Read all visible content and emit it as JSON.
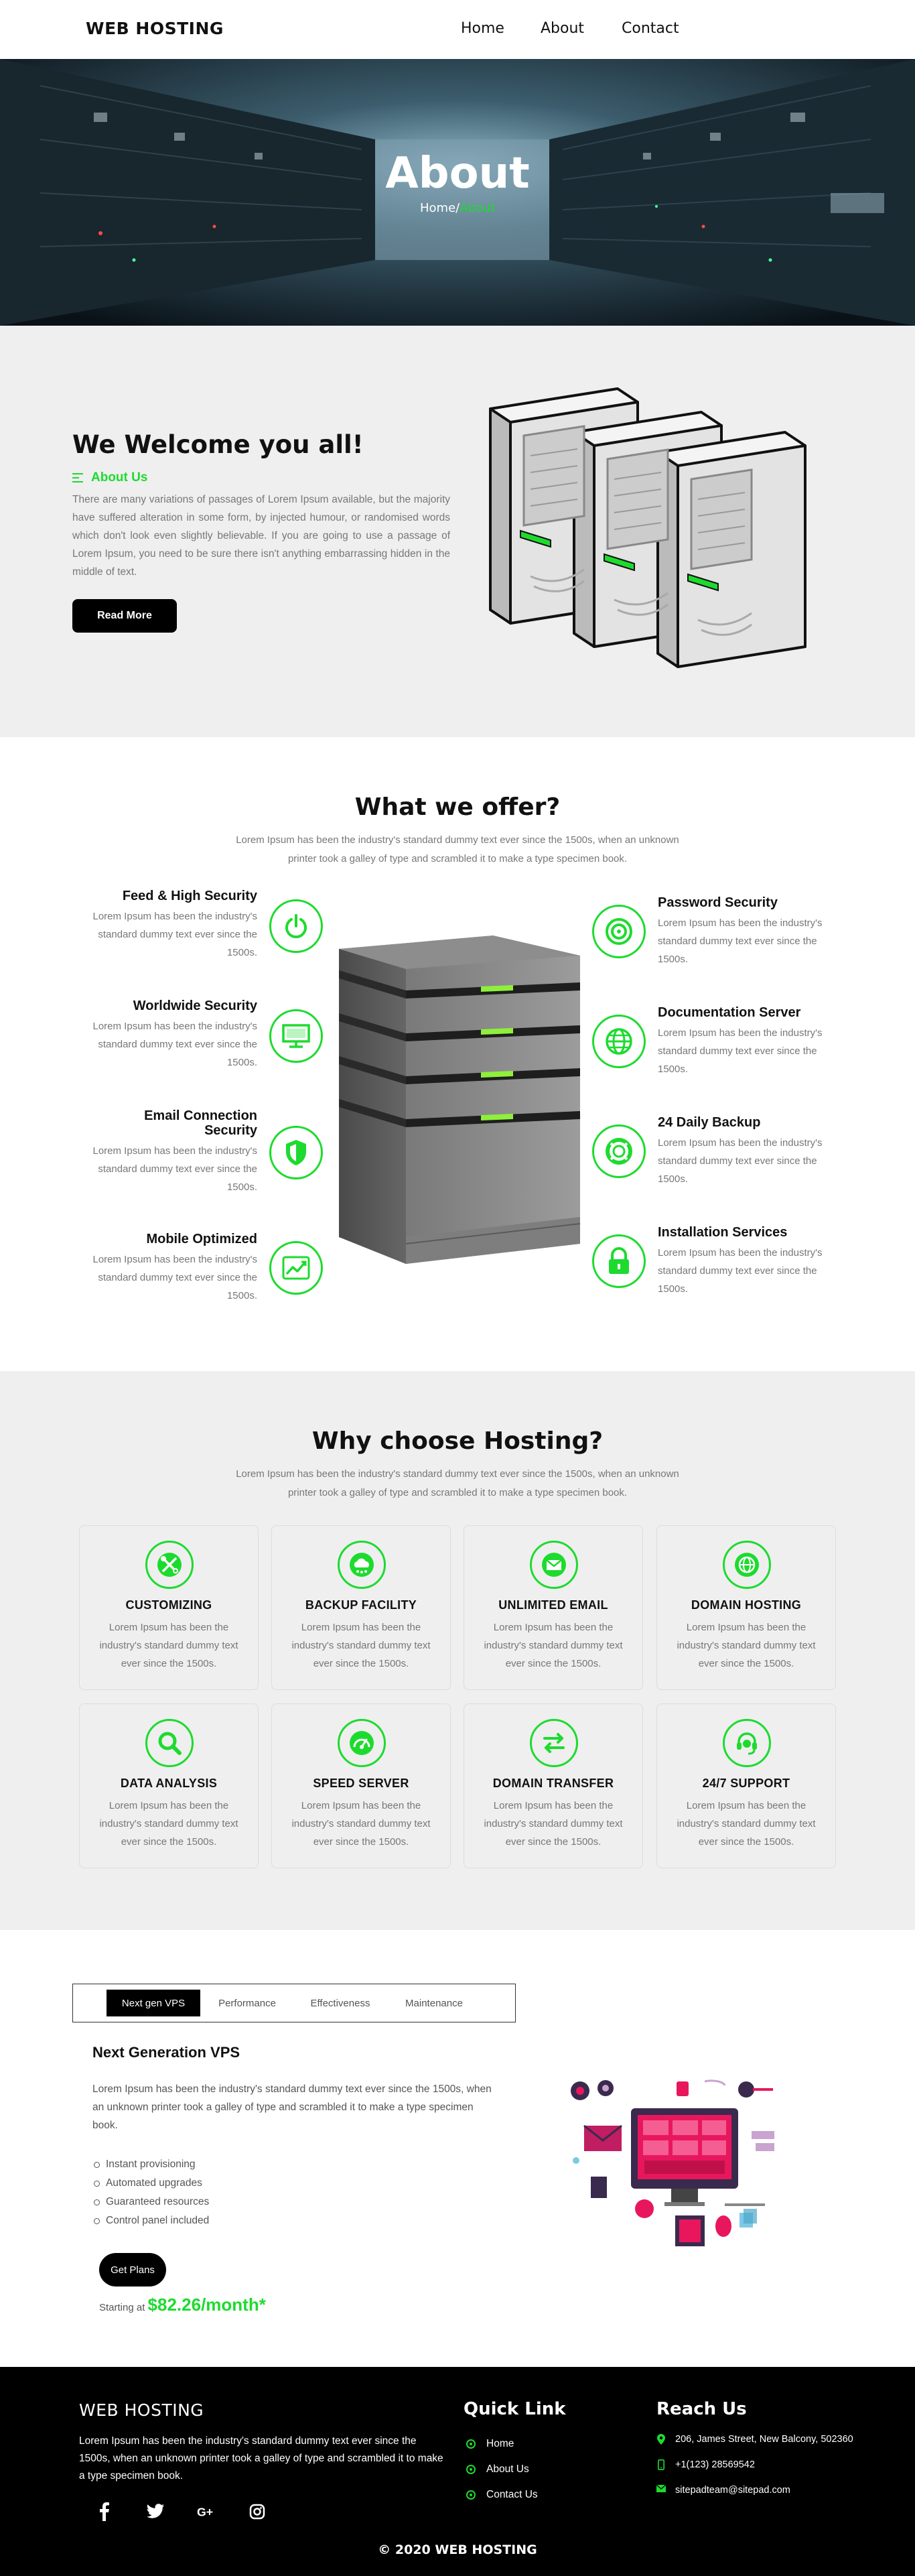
{
  "nav": {
    "brand": "WEB HOSTING",
    "items": [
      {
        "label": "Home"
      },
      {
        "label": "About"
      },
      {
        "label": "Contact"
      }
    ]
  },
  "hero": {
    "title": "About",
    "crumb_home": "Home",
    "crumb_sep": "/",
    "crumb_current": "About"
  },
  "welcome": {
    "heading": "We Welcome you all!",
    "subheading": "About Us",
    "body": "There are many variations of passages of Lorem Ipsum available, but the majority have suffered alteration in some form, by injected humour, or randomised words which don't look even slightly believable. If you are going to use a passage of Lorem Ipsum, you need to be sure there isn't anything embarrassing hidden in the middle of text.",
    "button": "Read More"
  },
  "offer": {
    "title": "What we offer?",
    "subtitle": "Lorem Ipsum has been the industry's standard dummy text ever since the 1500s, when an unknown printer took a galley of type and scrambled it to make a type specimen book.",
    "left": [
      {
        "title": "Feed & High Security",
        "text": "Lorem Ipsum has been the industry's standard dummy text ever since the 1500s.",
        "icon": "power-icon"
      },
      {
        "title": "Worldwide Security",
        "text": "Lorem Ipsum has been the industry's standard dummy text ever since the 1500s.",
        "icon": "monitor-icon"
      },
      {
        "title": "Email Connection Security",
        "text": "Lorem Ipsum has been the industry's standard dummy text ever since the 1500s.",
        "icon": "shield-icon"
      },
      {
        "title": "Mobile Optimized",
        "text": "Lorem Ipsum has been the industry's standard dummy text ever since the 1500s.",
        "icon": "chart-icon"
      }
    ],
    "right": [
      {
        "title": "Password Security",
        "text": "Lorem Ipsum has been the industry's standard dummy text ever since the 1500s.",
        "icon": "target-icon"
      },
      {
        "title": "Documentation Server",
        "text": "Lorem Ipsum has been the industry's standard dummy text ever since the 1500s.",
        "icon": "globe-icon"
      },
      {
        "title": "24 Daily Backup",
        "text": "Lorem Ipsum has been the industry's standard dummy text ever since the 1500s.",
        "icon": "lifebuoy-icon"
      },
      {
        "title": "Installation Services",
        "text": "Lorem Ipsum has been the industry's standard dummy text ever since the 1500s.",
        "icon": "lock-icon"
      }
    ]
  },
  "why": {
    "title": "Why choose Hosting?",
    "subtitle": "Lorem Ipsum has been the industry's standard dummy text ever since the 1500s, when an unknown printer took a galley of type and scrambled it to make a type specimen book.",
    "cards": [
      {
        "title": "CUSTOMIZING",
        "text": "Lorem Ipsum has been the industry's standard dummy text ever since the 1500s.",
        "icon": "tools-icon"
      },
      {
        "title": "BACKUP FACILITY",
        "text": "Lorem Ipsum has been the industry's standard dummy text ever since the 1500s.",
        "icon": "cloud-icon"
      },
      {
        "title": "UNLIMITED EMAIL",
        "text": "Lorem Ipsum has been the industry's standard dummy text ever since the 1500s.",
        "icon": "envelope-icon"
      },
      {
        "title": "DOMAIN HOSTING",
        "text": "Lorem Ipsum has been the industry's standard dummy text ever since the 1500s.",
        "icon": "globe-icon"
      },
      {
        "title": "DATA ANALYSIS",
        "text": "Lorem Ipsum has been the industry's standard dummy text ever since the 1500s.",
        "icon": "magnifier-icon"
      },
      {
        "title": "SPEED SERVER",
        "text": "Lorem Ipsum has been the industry's standard dummy text ever since the 1500s.",
        "icon": "gauge-icon"
      },
      {
        "title": "DOMAIN TRANSFER",
        "text": "Lorem Ipsum has been the industry's standard dummy text ever since the 1500s.",
        "icon": "transfer-icon"
      },
      {
        "title": "24/7 SUPPORT",
        "text": "Lorem Ipsum has been the industry's standard dummy text ever since the 1500s.",
        "icon": "headset-icon"
      }
    ]
  },
  "plans": {
    "tabs": [
      {
        "label": "Next gen VPS"
      },
      {
        "label": "Performance"
      },
      {
        "label": "Effectiveness"
      },
      {
        "label": "Maintenance"
      }
    ],
    "heading": "Next Generation VPS",
    "desc": "Lorem Ipsum has been the industry's standard dummy text ever since the 1500s, when an unknown printer took a galley of type and scrambled it to make a type specimen book.",
    "features": [
      "Instant provisioning",
      "Automated upgrades",
      "Guaranteed resources",
      "Control panel included"
    ],
    "button": "Get Plans",
    "starting": "Starting at",
    "price": "$82.26/month*"
  },
  "footer": {
    "brand": "WEB HOSTING",
    "about": "Lorem Ipsum has been the industry's standard dummy text ever since the 1500s, when an unknown printer took a galley of type and scrambled it to make a type specimen book.",
    "quick_title": "Quick Link",
    "quick_links": [
      {
        "label": "Home"
      },
      {
        "label": "About Us"
      },
      {
        "label": "Contact Us"
      }
    ],
    "reach_title": "Reach Us",
    "address": "206, James Street, New Balcony, 502360",
    "phone": "+1(123) 28569542",
    "email": "sitepadteam@sitepad.com",
    "copyright": "© 2020 WEB HOSTING"
  },
  "colors": {
    "accent": "#1ddb2e",
    "dark": "#000000",
    "section_bg": "#efefef"
  }
}
